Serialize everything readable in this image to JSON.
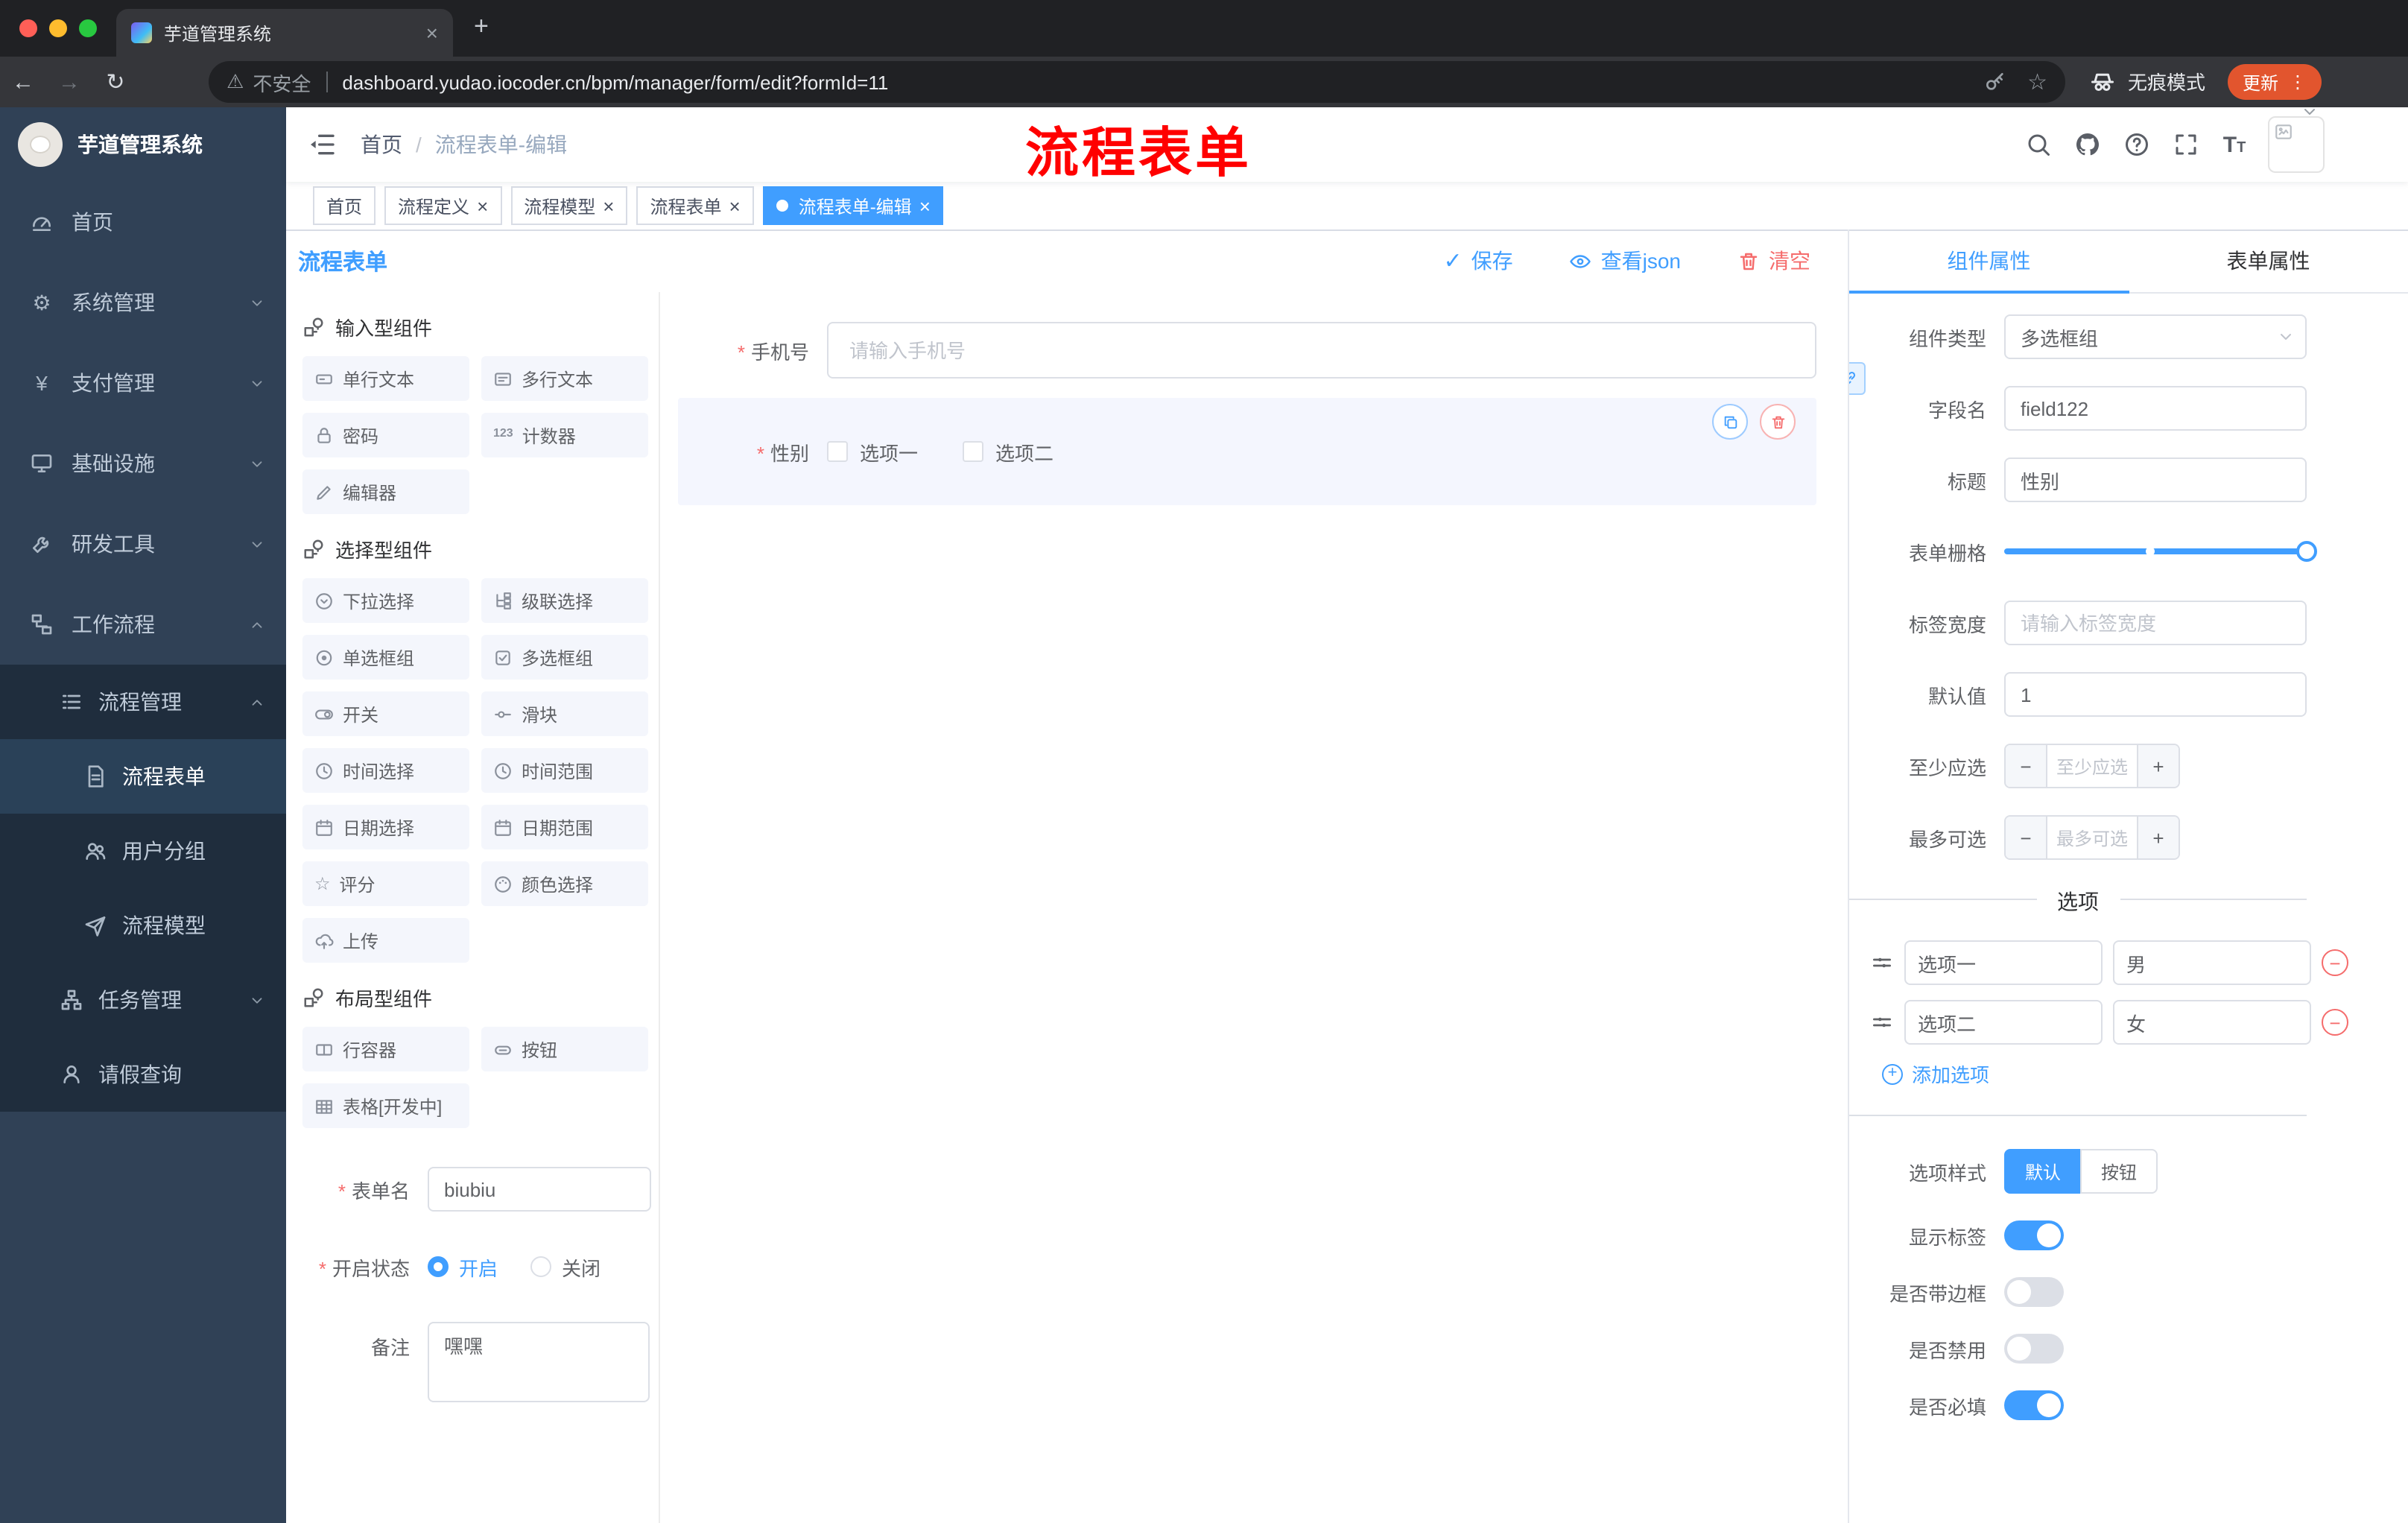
{
  "colors": {
    "accent": "#409eff",
    "danger": "#f56c6c",
    "annotation_red": "#ff0000",
    "sidebar_bg": "#304156",
    "submenu_bg": "#1f2d3d",
    "tag_active_bg": "#409eff",
    "update_pill_bg": "#e2552e"
  },
  "browser": {
    "tab_title": "芋道管理系统",
    "security_label": "不安全",
    "url": "dashboard.yudao.iocoder.cn/bpm/manager/form/edit?formId=11",
    "incognito_label": "无痕模式",
    "update_label": "更新"
  },
  "sidebar": {
    "logo_title": "芋道管理系统",
    "menu": [
      {
        "label": "首页",
        "icon": "dashboard-icon"
      },
      {
        "label": "系统管理",
        "icon": "gear-icon"
      },
      {
        "label": "支付管理",
        "icon": "yen-icon"
      },
      {
        "label": "基础设施",
        "icon": "monitor-icon"
      },
      {
        "label": "研发工具",
        "icon": "wrench-icon"
      },
      {
        "label": "工作流程",
        "icon": "workflow-icon"
      }
    ],
    "submenu": [
      {
        "label": "流程管理",
        "icon": "list-icon"
      },
      {
        "label": "流程表单",
        "icon": "document-icon"
      },
      {
        "label": "用户分组",
        "icon": "users-icon"
      },
      {
        "label": "流程模型",
        "icon": "paper-plane-icon"
      },
      {
        "label": "任务管理",
        "icon": "tree-icon"
      },
      {
        "label": "请假查询",
        "icon": "person-icon"
      }
    ]
  },
  "header": {
    "breadcrumb_home": "首页",
    "breadcrumb_sep": "/",
    "breadcrumb_current": "流程表单-编辑",
    "annotation": "流程表单"
  },
  "tags": [
    {
      "label": "首页"
    },
    {
      "label": "流程定义"
    },
    {
      "label": "流程模型"
    },
    {
      "label": "流程表单"
    },
    {
      "label": "流程表单-编辑"
    }
  ],
  "designer": {
    "title": "流程表单",
    "actions": {
      "save": "保存",
      "view_json": "查看json",
      "clear": "清空"
    },
    "palette": {
      "sections": [
        {
          "title": "输入型组件",
          "items": [
            "单行文本",
            "多行文本",
            "密码",
            "计数器",
            "编辑器"
          ]
        },
        {
          "title": "选择型组件",
          "items": [
            "下拉选择",
            "级联选择",
            "单选框组",
            "多选框组",
            "开关",
            "滑块",
            "时间选择",
            "时间范围",
            "日期选择",
            "日期范围",
            "评分",
            "颜色选择",
            "上传"
          ]
        },
        {
          "title": "布局型组件",
          "items": [
            "行容器",
            "按钮",
            "表格[开发中]"
          ]
        }
      ]
    },
    "meta": {
      "name_label": "表单名",
      "name_value": "biubiu",
      "status_label": "开启状态",
      "status_on": "开启",
      "status_off": "关闭",
      "remark_label": "备注",
      "remark_value": "嘿嘿"
    },
    "canvas": {
      "phone_label": "手机号",
      "phone_placeholder": "请输入手机号",
      "gender_label": "性别",
      "gender_option1": "选项一",
      "gender_option2": "选项二"
    },
    "props": {
      "tab_component": "组件属性",
      "tab_form": "表单属性",
      "component_type_label": "组件类型",
      "component_type_value": "多选框组",
      "field_name_label": "字段名",
      "field_name_value": "field122",
      "title_label": "标题",
      "title_value": "性别",
      "grid_label": "表单栅格",
      "label_width_label": "标签宽度",
      "label_width_placeholder": "请输入标签宽度",
      "default_label": "默认值",
      "default_value": "1",
      "min_label": "至少应选",
      "min_placeholder": "至少应选",
      "max_label": "最多可选",
      "max_placeholder": "最多可选",
      "options_title": "选项",
      "options": [
        {
          "name": "选项一",
          "value": "男"
        },
        {
          "name": "选项二",
          "value": "女"
        }
      ],
      "add_option": "添加选项",
      "style_label": "选项样式",
      "style_options": [
        "默认",
        "按钮"
      ],
      "switches": [
        {
          "label": "显示标签",
          "on": true
        },
        {
          "label": "是否带边框",
          "on": false
        },
        {
          "label": "是否禁用",
          "on": false
        },
        {
          "label": "是否必填",
          "on": true
        }
      ]
    }
  }
}
